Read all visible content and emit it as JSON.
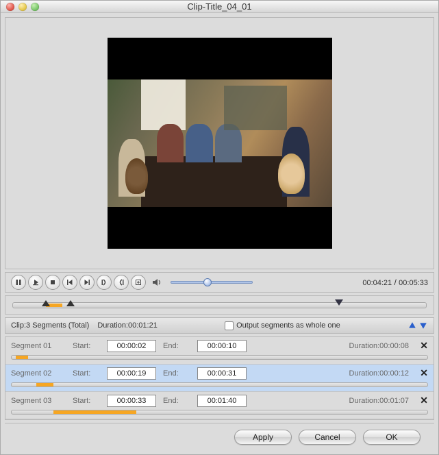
{
  "window": {
    "title": "Clip-Title_04_01"
  },
  "player": {
    "time_current": "00:04:21",
    "time_total": "00:05:33",
    "volume_slider_pct": 40,
    "timeline": {
      "in_pct": 7,
      "out_pct": 13,
      "segment_left_pct": 8,
      "segment_width_pct": 4,
      "playhead_pct": 78
    }
  },
  "info": {
    "clip_label_prefix": "Clip:",
    "segment_count": 3,
    "segments_label": "Segments (Total)",
    "duration_label": "Duration:",
    "duration_value": "00:01:21",
    "output_checkbox_label": "Output segments as whole one",
    "output_checked": false
  },
  "segments": [
    {
      "name": "Segment 01",
      "start_label": "Start:",
      "start": "00:00:02",
      "end_label": "End:",
      "end": "00:00:10",
      "duration_label": "Duration:",
      "duration": "00:00:08",
      "selected": false,
      "bar_left_pct": 1,
      "bar_width_pct": 3
    },
    {
      "name": "Segment 02",
      "start_label": "Start:",
      "start": "00:00:19",
      "end_label": "End:",
      "end": "00:00:31",
      "duration_label": "Duration:",
      "duration": "00:00:12",
      "selected": true,
      "bar_left_pct": 6,
      "bar_width_pct": 4
    },
    {
      "name": "Segment 03",
      "start_label": "Start:",
      "start": "00:00:33",
      "end_label": "End:",
      "end": "00:01:40",
      "duration_label": "Duration:",
      "duration": "00:01:07",
      "selected": false,
      "bar_left_pct": 10,
      "bar_width_pct": 20
    }
  ],
  "buttons": {
    "apply": "Apply",
    "cancel": "Cancel",
    "ok": "OK"
  }
}
